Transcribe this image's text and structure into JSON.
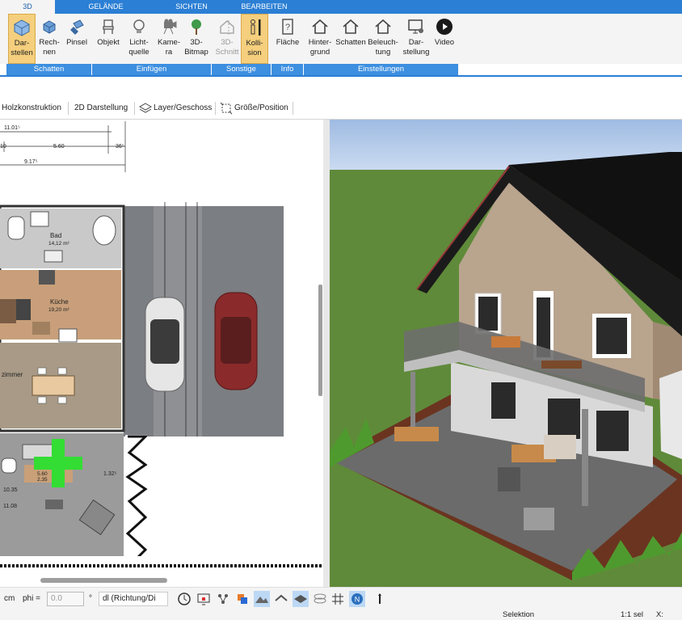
{
  "tabs": [
    {
      "label": "3D",
      "active": true
    },
    {
      "label": "GELÄNDE"
    },
    {
      "label": "SICHTEN"
    },
    {
      "label": "BEARBEITEN"
    }
  ],
  "ribbon": {
    "darstellen": "Dar-\nstellen",
    "rechnen": "Rech-\nnen",
    "pinsel": "Pinsel",
    "objekt": "Objekt",
    "lichtquelle": "Licht-\nquelle",
    "kamera": "Kame-\nra",
    "bitmap": "3D-\nBitmap",
    "schnitt": "3D-\nSchnitt",
    "kollision": "Kolli-\nsion",
    "flaeche": "Fläche",
    "hintergrund": "Hinter-\ngrund",
    "schatten": "Schatten",
    "beleuchtung": "Beleuch-\ntung",
    "darstellung": "Dar-\nstellung",
    "video": "Video"
  },
  "groups": {
    "schatten": "Schatten",
    "einfuegen": "Einfügen",
    "sonstige": "Sonstige",
    "info": "Info",
    "einstellungen": "Einstellungen"
  },
  "toolbar2": {
    "holz": "Holzkonstruktion",
    "darstellung2d": "2D Darstellung",
    "layer": "Layer/Geschoss",
    "groesse": "Größe/Position"
  },
  "plan": {
    "dims": [
      "11.01⁵",
      "10",
      "5.60",
      "36⁵",
      "9.17⁵",
      "1.32⁵",
      "10.35",
      "11.08"
    ],
    "rooms": {
      "bad": "Bad",
      "bad_area": "14,12 m²",
      "kueche": "Küche",
      "kueche_area": "19,20 m²",
      "zimmer": "zimmer",
      "terrace_dim1": "5.60",
      "terrace_dim2": "2.35"
    }
  },
  "bottom": {
    "unit": "cm",
    "phi_label": "phi =",
    "phi_value": "0.0",
    "degree": "°",
    "direction": "dl (Richtung/Di"
  },
  "status": {
    "selektion": "Selektion",
    "scale": "1:1 sel",
    "x": "X:"
  },
  "colors": {
    "ribbon_blue": "#2b7fd4",
    "group_blue": "#3d8fe0",
    "selected": "#f5cf7d",
    "sky": "#aac4e6",
    "grass": "#5f8a3a",
    "roof": "#1b1b1b",
    "facade_wood": "#b9a48e"
  }
}
